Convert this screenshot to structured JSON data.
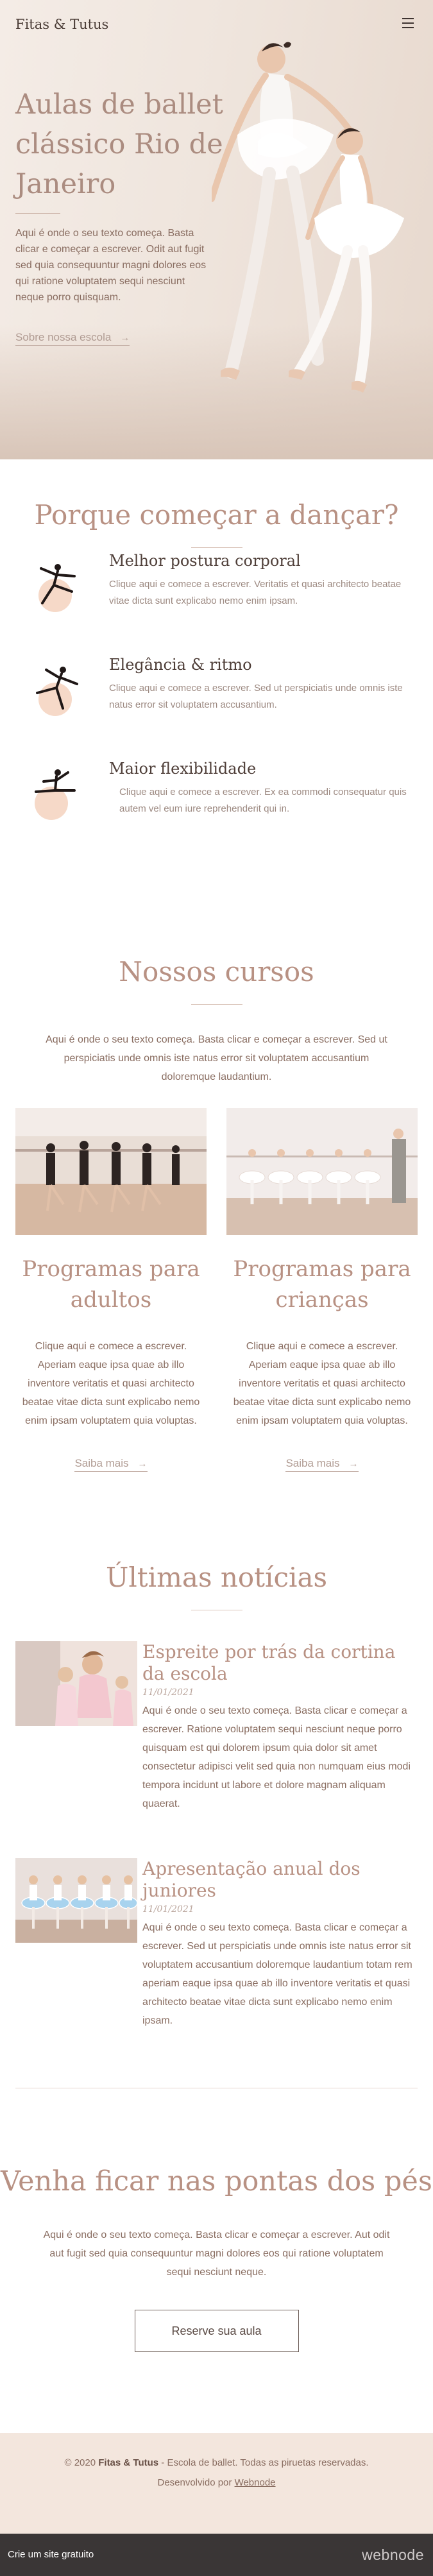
{
  "header": {
    "logo": "Fitas & Tutus",
    "menu_icon": "hamburger-icon"
  },
  "hero": {
    "title": "Aulas de ballet clássico Rio de Janeiro",
    "description": "Aqui é onde o seu texto começa. Basta clicar e começar a escrever. Odit aut fugit sed quia consequuntur magni dolores eos qui ratione voluptatem sequi nesciunt neque porro quisquam.",
    "link_label": "Sobre nossa escola",
    "link_icon": "arrow-right-icon"
  },
  "why": {
    "title": "Porque começar a dançar?",
    "features": [
      {
        "title": "Melhor postura corporal",
        "description": "Clique aqui e comece a escrever. Veritatis et quasi architecto beatae vitae dicta sunt explicabo nemo enim ipsam.",
        "icon": "dancer-leap-icon"
      },
      {
        "title": "Elegância & ritmo",
        "description": "Clique aqui e comece a escrever. Sed ut perspiciatis unde omnis iste natus error sit voluptatem accusantium.",
        "icon": "dancer-pose-icon"
      },
      {
        "title": "Maior flexibilidade",
        "description": "Clique aqui e comece a escrever. Ex ea commodi consequatur quis autem vel eum iure reprehenderit qui in.",
        "icon": "dancer-split-icon"
      }
    ]
  },
  "courses": {
    "title": "Nossos cursos",
    "intro": "Aqui é onde o seu texto começa. Basta clicar e começar a escrever. Sed ut perspiciatis unde omnis iste natus error sit voluptatem accusantium doloremque laudantium.",
    "items": [
      {
        "title": "Programas para adultos",
        "description": "Clique aqui e comece a escrever. Aperiam eaque ipsa quae ab illo inventore veritatis et quasi architecto beatae vitae dicta sunt explicabo nemo enim ipsam voluptatem quia voluptas.",
        "link_label": "Saiba mais"
      },
      {
        "title": "Programas para crianças",
        "description": "Clique aqui e comece a escrever. Aperiam eaque ipsa quae ab illo inventore veritatis et quasi architecto beatae vitae dicta sunt explicabo nemo enim ipsam voluptatem quia voluptas.",
        "link_label": "Saiba mais"
      }
    ]
  },
  "news": {
    "title": "Últimas notícias",
    "items": [
      {
        "title": "Espreite por trás da cortina da escola",
        "date": "11/01/2021",
        "description": "Aqui é onde o seu texto começa. Basta clicar e começar a escrever. Ratione voluptatem sequi nesciunt neque porro quisquam est qui dolorem ipsum quia dolor sit amet consectetur adipisci velit sed quia non numquam eius modi tempora incidunt ut labore et dolore magnam aliquam quaerat."
      },
      {
        "title": "Apresentação anual dos juniores",
        "date": "11/01/2021",
        "description": "Aqui é onde o seu texto começa. Basta clicar e começar a escrever. Sed ut perspiciatis unde omnis iste natus error sit voluptatem accusantium doloremque laudantium totam rem aperiam eaque ipsa quae ab illo inventore veritatis et quasi architecto beatae vitae dicta sunt explicabo nemo enim ipsam."
      }
    ]
  },
  "cta": {
    "title": "Venha ficar nas pontas dos pés",
    "description": "Aqui é onde o seu texto começa. Basta clicar e começar a escrever. Aut odit aut fugit sed quia consequuntur magni dolores eos qui ratione voluptatem sequi nesciunt neque.",
    "button_label": "Reserve sua aula"
  },
  "footer": {
    "copyright_prefix": "© 2020",
    "brand": "Fitas & Tutus",
    "copyright_suffix": "- Escola de ballet. Todas as piruetas reservadas.",
    "dev_label": "Desenvolvido por",
    "dev_link": "Webnode"
  },
  "webnode_bar": {
    "left_label": "Crie um site gratuito",
    "right_logo": "webnode"
  },
  "colors": {
    "accent": "#b89183",
    "heading_dark": "#4f3f39",
    "body_text": "#8a6e62",
    "footer_bg": "#f3e6dd",
    "bar_bg": "#3a3636",
    "icon_circle": "#f6d9c8"
  }
}
